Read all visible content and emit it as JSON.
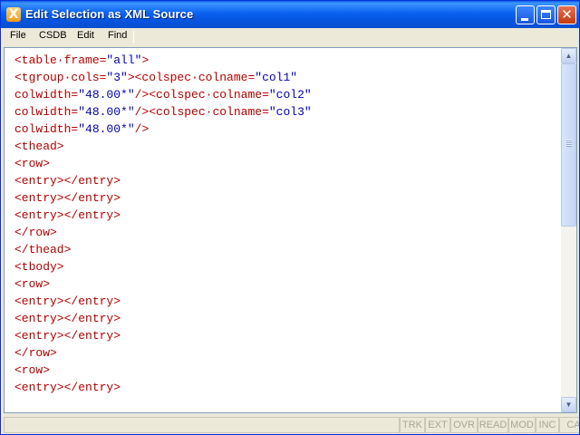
{
  "window": {
    "title": "Edit Selection as XML Source",
    "app_icon_glyph": "X",
    "controls": {
      "minimize": "minimize-icon",
      "maximize": "maximize-icon",
      "close": "close-icon",
      "close_glyph": "✕"
    }
  },
  "menu": {
    "items": [
      {
        "label": "File"
      },
      {
        "label": "CSDB"
      },
      {
        "label": "Edit"
      },
      {
        "label": "Find"
      }
    ]
  },
  "editor": {
    "lines": [
      [
        {
          "t": "tag",
          "v": "<table·frame="
        },
        {
          "t": "val",
          "v": "\"all\""
        },
        {
          "t": "tag",
          "v": ">"
        }
      ],
      [
        {
          "t": "tag",
          "v": "<tgroup·cols="
        },
        {
          "t": "val",
          "v": "\"3\""
        },
        {
          "t": "tag",
          "v": "><colspec·colname="
        },
        {
          "t": "val",
          "v": "\"col1\""
        }
      ],
      [
        {
          "t": "tag",
          "v": "colwidth="
        },
        {
          "t": "val",
          "v": "\"48.00*\""
        },
        {
          "t": "tag",
          "v": "/><colspec·colname="
        },
        {
          "t": "val",
          "v": "\"col2\""
        }
      ],
      [
        {
          "t": "tag",
          "v": "colwidth="
        },
        {
          "t": "val",
          "v": "\"48.00*\""
        },
        {
          "t": "tag",
          "v": "/><colspec·colname="
        },
        {
          "t": "val",
          "v": "\"col3\""
        }
      ],
      [
        {
          "t": "tag",
          "v": "colwidth="
        },
        {
          "t": "val",
          "v": "\"48.00*\""
        },
        {
          "t": "tag",
          "v": "/>"
        }
      ],
      [
        {
          "t": "tag",
          "v": "<thead>"
        }
      ],
      [
        {
          "t": "tag",
          "v": "<row>"
        }
      ],
      [
        {
          "t": "tag",
          "v": "<entry></entry>"
        }
      ],
      [
        {
          "t": "tag",
          "v": "<entry></entry>"
        }
      ],
      [
        {
          "t": "tag",
          "v": "<entry></entry>"
        }
      ],
      [
        {
          "t": "tag",
          "v": "</row>"
        }
      ],
      [
        {
          "t": "tag",
          "v": "</thead>"
        }
      ],
      [
        {
          "t": "tag",
          "v": "<tbody>"
        }
      ],
      [
        {
          "t": "tag",
          "v": "<row>"
        }
      ],
      [
        {
          "t": "tag",
          "v": "<entry></entry>"
        }
      ],
      [
        {
          "t": "tag",
          "v": "<entry></entry>"
        }
      ],
      [
        {
          "t": "tag",
          "v": "<entry></entry>"
        }
      ],
      [
        {
          "t": "tag",
          "v": "</row>"
        }
      ],
      [
        {
          "t": "tag",
          "v": "<row>"
        }
      ],
      [
        {
          "t": "tag",
          "v": "<entry></entry>"
        }
      ]
    ]
  },
  "status": {
    "main_text": "",
    "indicators": {
      "trk": "TRK",
      "ext": "EXT",
      "ovr": "OVR",
      "read": "READ",
      "mod": "MOD",
      "inc": "INC",
      "caps": "CA"
    }
  },
  "colors": {
    "tag": "#b30000",
    "value": "#0000b3",
    "titlebar": "#0a62f0"
  }
}
